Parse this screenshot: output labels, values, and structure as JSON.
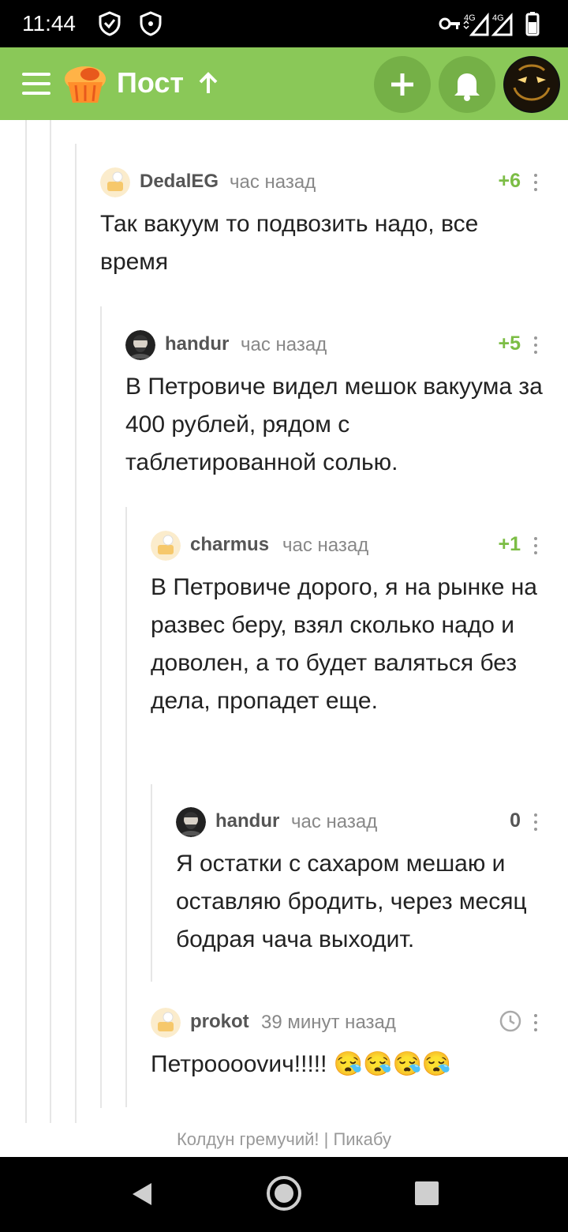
{
  "status": {
    "time": "11:44",
    "net1": "4G",
    "net2": "4G"
  },
  "appbar": {
    "title": "Пост"
  },
  "comments": [
    {
      "user": "DedalEG",
      "time": "час назад",
      "rating": "+6",
      "text": "Так вакуум то подвозить надо, все время"
    },
    {
      "user": "handur",
      "time": "час назад",
      "rating": "+5",
      "text": "В Петровиче видел мешок вакуума за 400 рублей, рядом с таблетированной солью."
    },
    {
      "user": "charmus",
      "time": "час назад",
      "rating": "+1",
      "text": "В Петровиче дорого, я на рынке на развес беру, взял сколько надо и доволен, а то будет валяться без дела, пропадет еще."
    },
    {
      "user": "handur",
      "time": "час назад",
      "rating": "0",
      "text": "Я остатки с сахаром мешаю и оставляю бродить, через месяц бодрая чача выходит."
    },
    {
      "user": "prokot",
      "time": "39 минут назад",
      "rating": "",
      "text": "Петрооооvич!!!!! 😪😪😪😪"
    }
  ],
  "footer": "Колдун гремучий! | Пикабу",
  "colors": {
    "appbar": "#8ac858",
    "accent": "#7cbd45"
  }
}
